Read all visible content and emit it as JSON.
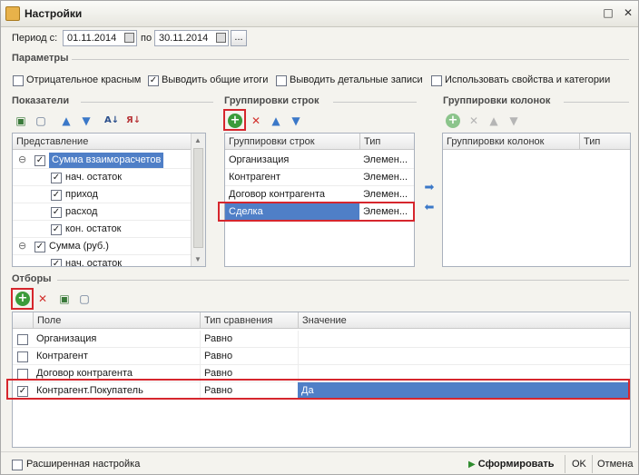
{
  "window": {
    "title": "Настройки",
    "controls": {
      "pin": "□",
      "close": "✕"
    }
  },
  "period": {
    "label_from": "Период с:",
    "from": "01.11.2014",
    "label_to": "по",
    "to": "30.11.2014",
    "more_button": "..."
  },
  "params": {
    "title": "Параметры",
    "options": [
      {
        "label": "Отрицательное красным",
        "checked": false
      },
      {
        "label": "Выводить общие итоги",
        "checked": true
      },
      {
        "label": "Выводить детальные записи",
        "checked": false
      },
      {
        "label": "Использовать свойства и категории",
        "checked": false
      }
    ]
  },
  "indicators": {
    "title": "Показатели",
    "header": "Представление",
    "items": [
      {
        "label": "Сумма взаиморасчетов",
        "checked": true,
        "expanded": true,
        "selected": true
      },
      {
        "label": "нач. остаток",
        "checked": true
      },
      {
        "label": "приход",
        "checked": true
      },
      {
        "label": "расход",
        "checked": true
      },
      {
        "label": "кон. остаток",
        "checked": true
      },
      {
        "label": "Сумма (руб.)",
        "checked": true,
        "expanded": true
      },
      {
        "label": "нач. остаток",
        "checked": true
      }
    ],
    "toolbar": {
      "sort_asc": "А↓",
      "sort_desc": "Я↓"
    }
  },
  "row_groups": {
    "title": "Группировки строк",
    "headers": [
      "Группировки строк",
      "Тип"
    ],
    "rows": [
      {
        "name": "Организация",
        "type": "Элемен..."
      },
      {
        "name": "Контрагент",
        "type": "Элемен..."
      },
      {
        "name": "Договор контрагента",
        "type": "Элемен..."
      },
      {
        "name": "Сделка",
        "type": "Элемен...",
        "selected": true
      }
    ]
  },
  "col_groups": {
    "title": "Группировки колонок",
    "headers": [
      "Группировки колонок",
      "Тип"
    ]
  },
  "filters": {
    "title": "Отборы",
    "headers": [
      "Поле",
      "Тип сравнения",
      "Значение"
    ],
    "rows": [
      {
        "field": "Организация",
        "compare": "Равно",
        "value": "",
        "checked": false
      },
      {
        "field": "Контрагент",
        "compare": "Равно",
        "value": "",
        "checked": false
      },
      {
        "field": "Договор контрагента",
        "compare": "Равно",
        "value": "",
        "checked": false
      },
      {
        "field": "Контрагент.Покупатель",
        "compare": "Равно",
        "value": "Да",
        "checked": true
      }
    ]
  },
  "footer": {
    "advanced": "Расширенная настройка",
    "generate": "Сформировать",
    "ok": "OK",
    "cancel": "Отмена"
  },
  "colors": {
    "accent_red": "#d6262d",
    "selection": "#4f7fc7",
    "add_green": "#3a9b3a"
  }
}
